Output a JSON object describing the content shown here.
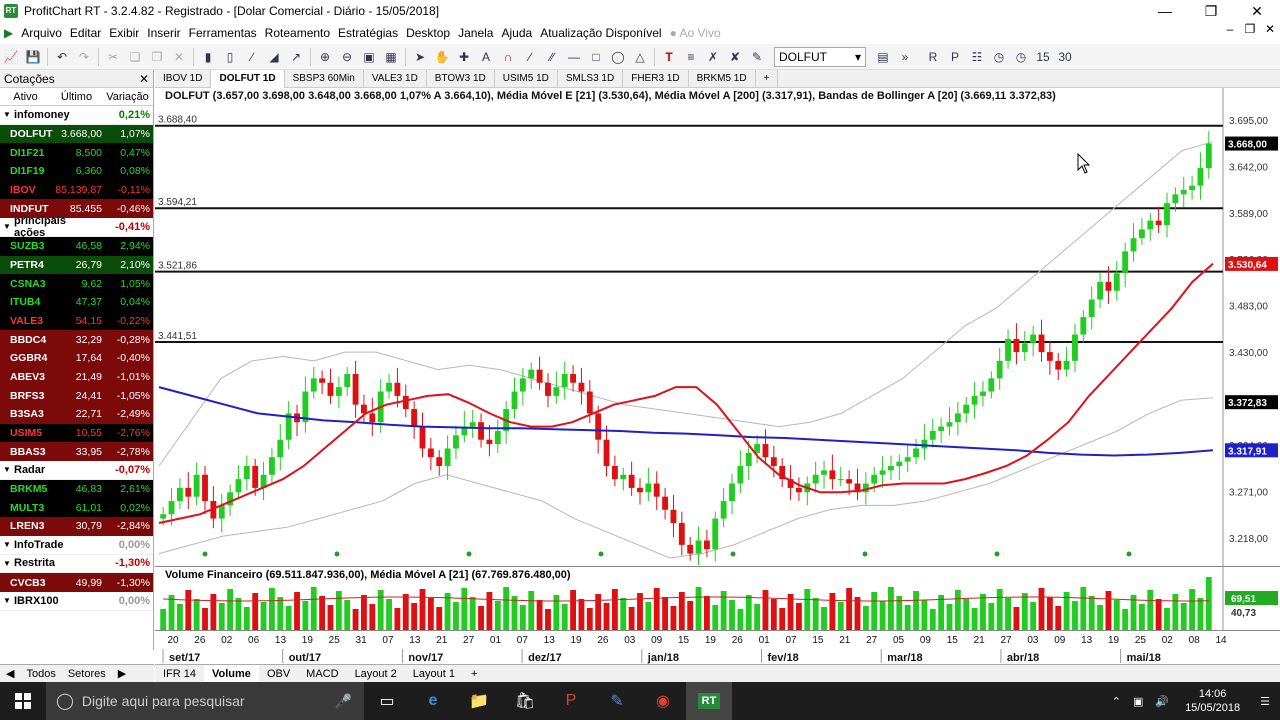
{
  "window": {
    "title": "ProfitChart RT - 3.2.4.82 - Registrado - [Dolar Comercial - Diário - 15/05/2018]",
    "icon_label": "RT"
  },
  "menu": {
    "items": [
      "Arquivo",
      "Editar",
      "Exibir",
      "Inserir",
      "Ferramentas",
      "Roteamento",
      "Estratégias",
      "Desktop",
      "Janela",
      "Ajuda",
      "Atualização Disponível"
    ],
    "status": "Ao Vivo"
  },
  "toolbar": {
    "symbol": "DOLFUT",
    "r_labels": [
      "15",
      "30"
    ]
  },
  "quotes": {
    "title": "Cotações",
    "columns": [
      "Ativo",
      "Último",
      "Variação"
    ],
    "groups": [
      {
        "name": "infomoney",
        "change": "0,21%",
        "color": "#008000",
        "rows": [
          {
            "sym": "DOLFUT",
            "last": "3.668,00",
            "var": "1,07%",
            "dir": "up",
            "hl": true
          },
          {
            "sym": "DI1F21",
            "last": "8,500",
            "var": "0,47%",
            "dir": "up"
          },
          {
            "sym": "DI1F19",
            "last": "6,360",
            "var": "0,08%",
            "dir": "up"
          },
          {
            "sym": "IBOV",
            "last": "85.139,87",
            "var": "-0,11%",
            "dir": "down"
          },
          {
            "sym": "INDFUT",
            "last": "85.455",
            "var": "-0,46%",
            "dir": "down",
            "hl": true
          }
        ]
      },
      {
        "name": "principais ações",
        "change": "-0,41%",
        "color": "#c00000",
        "rows": [
          {
            "sym": "SUZB3",
            "last": "46,58",
            "var": "2,94%",
            "dir": "up"
          },
          {
            "sym": "PETR4",
            "last": "26,79",
            "var": "2,10%",
            "dir": "up",
            "hl": true
          },
          {
            "sym": "CSNA3",
            "last": "9,62",
            "var": "1,05%",
            "dir": "up"
          },
          {
            "sym": "ITUB4",
            "last": "47,37",
            "var": "0,04%",
            "dir": "up"
          },
          {
            "sym": "VALE3",
            "last": "54,15",
            "var": "-0,22%",
            "dir": "down"
          },
          {
            "sym": "BBDC4",
            "last": "32,29",
            "var": "-0,28%",
            "dir": "down",
            "hl": true
          },
          {
            "sym": "GGBR4",
            "last": "17,64",
            "var": "-0,40%",
            "dir": "down",
            "hl": true
          },
          {
            "sym": "ABEV3",
            "last": "21,49",
            "var": "-1,01%",
            "dir": "down",
            "hl": true
          },
          {
            "sym": "BRFS3",
            "last": "24,41",
            "var": "-1,05%",
            "dir": "down",
            "hl": true
          },
          {
            "sym": "B3SA3",
            "last": "22,71",
            "var": "-2,49%",
            "dir": "down",
            "hl": true
          },
          {
            "sym": "USIM5",
            "last": "10,55",
            "var": "-2,76%",
            "dir": "down"
          },
          {
            "sym": "BBAS3",
            "last": "33,95",
            "var": "-2,78%",
            "dir": "down",
            "hl": true
          }
        ]
      },
      {
        "name": "Radar",
        "change": "-0,07%",
        "color": "#c00000",
        "rows": [
          {
            "sym": "BRKM5",
            "last": "46,83",
            "var": "2,61%",
            "dir": "up"
          },
          {
            "sym": "MULT3",
            "last": "61,01",
            "var": "0,02%",
            "dir": "up"
          },
          {
            "sym": "LREN3",
            "last": "30,79",
            "var": "-2,84%",
            "dir": "down",
            "hl": true
          }
        ]
      },
      {
        "name": "InfoTrade",
        "change": "0,00%",
        "color": "#999999",
        "rows": []
      },
      {
        "name": "Restrita",
        "change": "-1,30%",
        "color": "#c00000",
        "rows": [
          {
            "sym": "CVCB3",
            "last": "49,99",
            "var": "-1,30%",
            "dir": "down",
            "hl": true
          }
        ]
      },
      {
        "name": "IBRX100",
        "change": "0,00%",
        "color": "#999999",
        "rows": []
      }
    ],
    "tabs": [
      "Todos",
      "Setores"
    ]
  },
  "chart_tabs": [
    "IBOV 1D",
    "DOLFUT 1D",
    "SBSP3 60Min",
    "VALE3 1D",
    "BTOW3 1D",
    "USIM5 1D",
    "SMLS3 1D",
    "FHER3 1D",
    "BRKM5 1D",
    "+"
  ],
  "bottom_tabs": [
    "IFR 14",
    "Volume",
    "OBV",
    "MACD",
    "Layout 2",
    "Layout 1",
    "+"
  ],
  "legend": {
    "text": "DOLFUT (3.657,00  3.698,00  3.648,00  3.668,00  1,07%  A 3.664,10), Média Móvel E [21] (3.530,64), Média Móvel A [200] (3.317,91), Bandas de Bollinger A [20] (3.669,11  3.372,83)",
    "vol_text": "Volume Financeiro (69.511.847.936,00), Média Móvel A [21] (67.769.876.480,00)"
  },
  "colors": {
    "up": "#22cc22",
    "down": "#dd1111",
    "ema": "#e0101a",
    "sma200": "#2020c8",
    "bollinger": "#b8b8b8",
    "hline": "#111111"
  },
  "chart_data": {
    "type": "candlestick",
    "y_ticks": [
      "3.695,00",
      "3.642,00",
      "3.589,00",
      "3.536,00",
      "3.483,00",
      "3.430,00",
      "3.377,00",
      "3.324,00",
      "3.271,00",
      "3.218,00"
    ],
    "ylim": [
      3195,
      3720
    ],
    "h_lines": [
      {
        "value": 3688.4,
        "label": "3.688,40"
      },
      {
        "value": 3594.21,
        "label": "3.594,21"
      },
      {
        "value": 3521.86,
        "label": "3.521,86"
      },
      {
        "value": 3441.51,
        "label": "3.441,51"
      }
    ],
    "price_tags": [
      {
        "label": "3.668,00",
        "value": 3668.0,
        "bg": "#000000"
      },
      {
        "label": "3.530,64",
        "value": 3530.64,
        "bg": "#dd1111"
      },
      {
        "label": "3.372,83",
        "value": 3372.83,
        "bg": "#000000"
      },
      {
        "label": "3.317,91",
        "value": 3317.91,
        "bg": "#2020c8"
      }
    ],
    "candle_path": [
      3245,
      3260,
      3275,
      3265,
      3290,
      3260,
      3240,
      3255,
      3270,
      3285,
      3300,
      3275,
      3290,
      3310,
      3330,
      3360,
      3350,
      3385,
      3400,
      3395,
      3380,
      3390,
      3405,
      3370,
      3360,
      3350,
      3385,
      3395,
      3380,
      3365,
      3345,
      3320,
      3310,
      3300,
      3320,
      3335,
      3345,
      3350,
      3330,
      3325,
      3340,
      3365,
      3385,
      3400,
      3410,
      3395,
      3380,
      3390,
      3405,
      3395,
      3385,
      3360,
      3330,
      3300,
      3285,
      3290,
      3275,
      3270,
      3280,
      3265,
      3250,
      3235,
      3210,
      3200,
      3215,
      3205,
      3240,
      3260,
      3280,
      3300,
      3315,
      3325,
      3310,
      3300,
      3285,
      3275,
      3270,
      3280,
      3290,
      3295,
      3285,
      3285,
      3280,
      3270,
      3280,
      3290,
      3295,
      3300,
      3305,
      3310,
      3320,
      3330,
      3340,
      3345,
      3350,
      3360,
      3370,
      3380,
      3385,
      3400,
      3420,
      3445,
      3430,
      3440,
      3450,
      3430,
      3420,
      3410,
      3420,
      3450,
      3470,
      3490,
      3510,
      3500,
      3520,
      3545,
      3560,
      3570,
      3580,
      3575,
      3600,
      3610,
      3615,
      3620,
      3640,
      3668
    ],
    "ema21_path": [
      3235,
      3240,
      3245,
      3255,
      3265,
      3275,
      3285,
      3300,
      3320,
      3340,
      3360,
      3370,
      3375,
      3380,
      3382,
      3372,
      3360,
      3350,
      3345,
      3345,
      3350,
      3360,
      3370,
      3375,
      3380,
      3390,
      3390,
      3370,
      3340,
      3310,
      3290,
      3278,
      3270,
      3270,
      3272,
      3278,
      3280,
      3280,
      3280,
      3285,
      3292,
      3300,
      3312,
      3330,
      3350,
      3380,
      3405,
      3430,
      3455,
      3480,
      3510,
      3531
    ],
    "sma200_path": [
      3390,
      3380,
      3370,
      3360,
      3356,
      3352,
      3350,
      3347,
      3345,
      3344,
      3343,
      3343,
      3342,
      3341,
      3340,
      3338,
      3337,
      3335,
      3333,
      3332,
      3330,
      3328,
      3326,
      3324,
      3322,
      3320,
      3318,
      3315,
      3313,
      3312,
      3313,
      3315,
      3318
    ],
    "boll_upper_path": [
      3300,
      3350,
      3400,
      3420,
      3425,
      3420,
      3430,
      3430,
      3420,
      3410,
      3415,
      3410,
      3400,
      3390,
      3380,
      3370,
      3365,
      3360,
      3355,
      3350,
      3345,
      3350,
      3360,
      3380,
      3400,
      3430,
      3460,
      3480,
      3510,
      3540,
      3570,
      3600,
      3630,
      3660,
      3670
    ],
    "boll_lower_path": [
      3200,
      3210,
      3220,
      3225,
      3230,
      3240,
      3250,
      3260,
      3280,
      3290,
      3280,
      3270,
      3260,
      3240,
      3225,
      3210,
      3195,
      3200,
      3210,
      3225,
      3240,
      3250,
      3255,
      3255,
      3260,
      3270,
      3280,
      3295,
      3310,
      3325,
      3340,
      3360,
      3375,
      3378
    ],
    "volume": {
      "ticks": [
        "69,51",
        "40,73"
      ],
      "max": 1.0
    },
    "x_labels": [
      "20",
      "26",
      "02",
      "06",
      "13",
      "19",
      "25",
      "31",
      "07",
      "13",
      "21",
      "27",
      "01",
      "07",
      "13",
      "19",
      "26",
      "03",
      "09",
      "15",
      "19",
      "26",
      "01",
      "07",
      "15",
      "21",
      "27",
      "05",
      "09",
      "15",
      "21",
      "27",
      "03",
      "09",
      "13",
      "19",
      "25",
      "02",
      "08",
      "14"
    ],
    "months": [
      "set/17",
      "out/17",
      "nov/17",
      "dez/17",
      "jan/18",
      "fev/18",
      "mar/18",
      "abr/18",
      "mai/18"
    ]
  },
  "taskbar": {
    "search_placeholder": "Digite aqui para pesquisar",
    "time": "14:06",
    "date": "15/05/2018",
    "rt_label": "RT"
  }
}
